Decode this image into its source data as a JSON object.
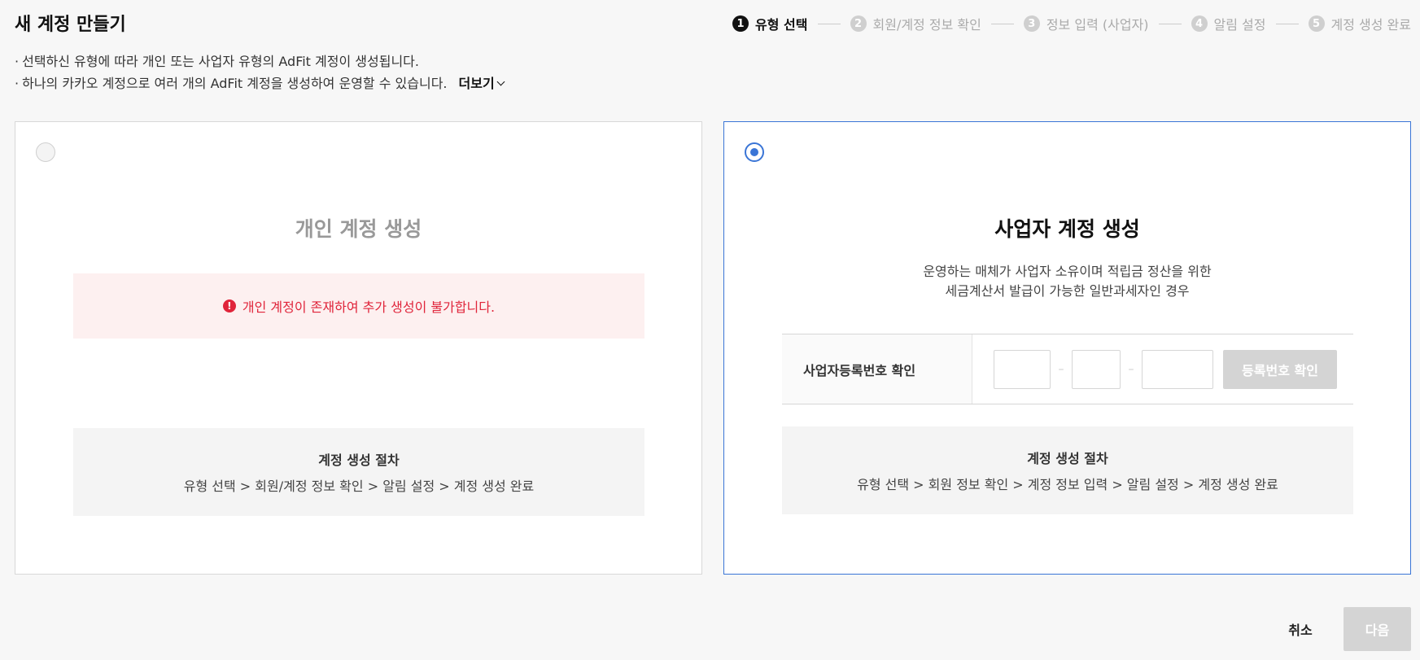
{
  "page": {
    "title": "새 계정 만들기"
  },
  "stepper": {
    "steps": [
      {
        "num": "1",
        "label": "유형 선택",
        "active": true
      },
      {
        "num": "2",
        "label": "회원/계정 정보 확인",
        "active": false
      },
      {
        "num": "3",
        "label": "정보 입력 (사업자)",
        "active": false
      },
      {
        "num": "4",
        "label": "알림 설정",
        "active": false
      },
      {
        "num": "5",
        "label": "계정 생성 완료",
        "active": false
      }
    ]
  },
  "description": {
    "bullet": "·",
    "line1": "선택하신 유형에 따라 개인 또는 사업자 유형의 AdFit 계정이 생성됩니다.",
    "line2": "하나의 카카오 계정으로 여러 개의 AdFit 계정을 생성하여 운영할 수 있습니다.",
    "more_label": "더보기"
  },
  "personal_card": {
    "title": "개인 계정 생성",
    "selected": false,
    "warning_icon": "!",
    "warning": "개인 계정이 존재하여 추가 생성이 불가합니다.",
    "process_title": "계정 생성 절차",
    "process_steps": "유형 선택 > 회원/계정 정보 확인 > 알림 설정 > 계정 생성 완료"
  },
  "business_card": {
    "title": "사업자 계정 생성",
    "selected": true,
    "desc_line1": "운영하는 매체가 사업자 소유이며 적립금 정산을 위한",
    "desc_line2": "세금계산서 발급이 가능한 일반과세자인 경우",
    "reg_label": "사업자등록번호 확인",
    "reg_input1": "",
    "reg_input2": "",
    "reg_input3": "",
    "dash": "–",
    "reg_button": "등록번호 확인",
    "process_title": "계정 생성 절차",
    "process_steps": "유형 선택 > 회원 정보 확인 > 계정 정보 입력 > 알림 설정 > 계정 생성 완료"
  },
  "footer": {
    "cancel_label": "취소",
    "next_label": "다음"
  },
  "colors": {
    "accent": "#3a75d6",
    "error": "#e0243a",
    "disabled": "#d4d4d4"
  }
}
